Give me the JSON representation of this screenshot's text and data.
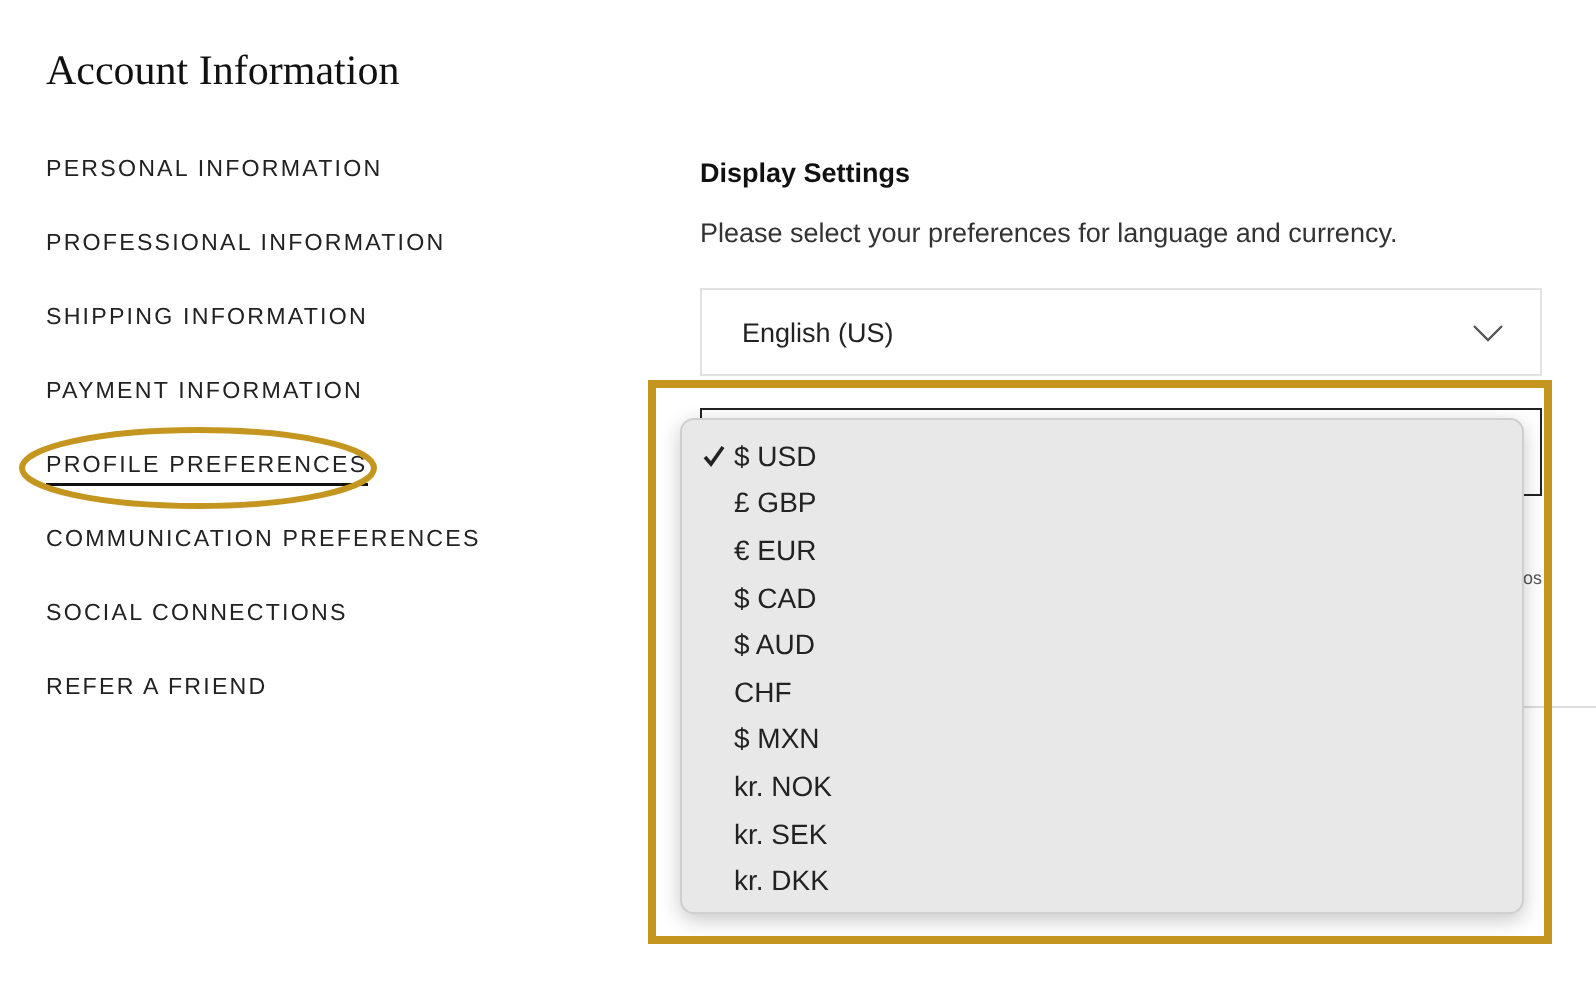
{
  "page": {
    "title": "Account Information"
  },
  "sidebar": {
    "items": [
      {
        "label": "PERSONAL INFORMATION",
        "selected": false
      },
      {
        "label": "PROFESSIONAL INFORMATION",
        "selected": false
      },
      {
        "label": "SHIPPING INFORMATION",
        "selected": false
      },
      {
        "label": "PAYMENT INFORMATION",
        "selected": false
      },
      {
        "label": "PROFILE PREFERENCES",
        "selected": true
      },
      {
        "label": "COMMUNICATION PREFERENCES",
        "selected": false
      },
      {
        "label": "SOCIAL CONNECTIONS",
        "selected": false
      },
      {
        "label": "REFER A FRIEND",
        "selected": false
      }
    ]
  },
  "display_settings": {
    "title": "Display Settings",
    "description": "Please select your preferences for language and currency.",
    "language_select": {
      "value": "English (US)"
    },
    "note_fragment": "os"
  },
  "currency_menu": {
    "options": [
      {
        "label": "$ USD",
        "selected": true
      },
      {
        "label": "£ GBP",
        "selected": false
      },
      {
        "label": "€ EUR",
        "selected": false
      },
      {
        "label": "$ CAD",
        "selected": false
      },
      {
        "label": "$ AUD",
        "selected": false
      },
      {
        "label": "CHF",
        "selected": false
      },
      {
        "label": "$ MXN",
        "selected": false
      },
      {
        "label": "kr. NOK",
        "selected": false
      },
      {
        "label": "kr. SEK",
        "selected": false
      },
      {
        "label": "kr. DKK",
        "selected": false
      }
    ]
  }
}
